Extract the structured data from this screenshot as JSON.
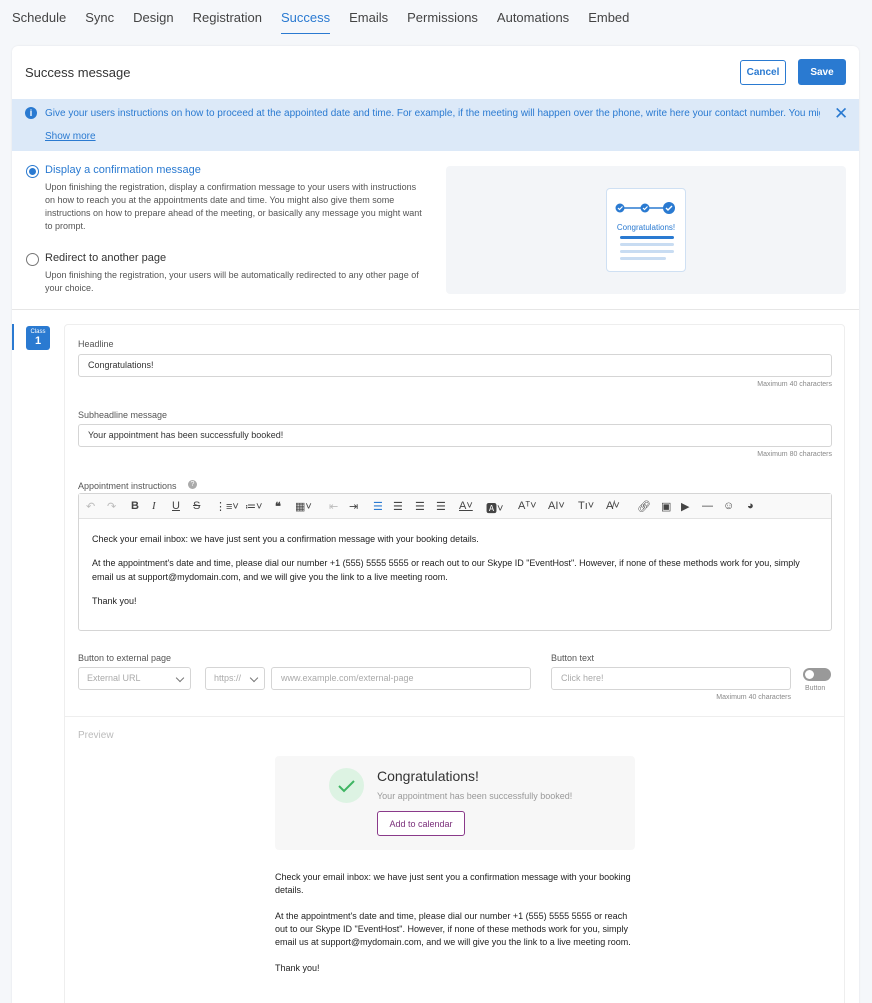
{
  "tabs": [
    "Schedule",
    "Sync",
    "Design",
    "Registration",
    "Success",
    "Emails",
    "Permissions",
    "Automations",
    "Embed"
  ],
  "active_tab": "Success",
  "card": {
    "title": "Success message",
    "cancel_label": "Cancel",
    "save_label": "Save"
  },
  "info": {
    "text": "Give your users instructions on how to proceed at the appointed date and time. For example, if the meeting will happen over the phone, write here your contact number. You might also poi...",
    "show_more": "Show more"
  },
  "options": [
    {
      "title": "Display a confirmation message",
      "selected": true,
      "desc": "Upon finishing the registration, display a confirmation message to your users with instructions on how to reach you at the appointments date and time. You might also give them some instructions on how to prepare ahead of the meeting, or basically any message you might want to prompt."
    },
    {
      "title": "Redirect to another page",
      "selected": false,
      "desc": "Upon finishing the registration, your users will be automatically redirected to any other page of your choice."
    }
  ],
  "illustration": {
    "label": "Congratulations!"
  },
  "class_badge": {
    "label": "Class",
    "number": "1"
  },
  "form": {
    "headline_label": "Headline",
    "headline_value": "Congratulations!",
    "headline_hint": "Maximum 40 characters",
    "subheadline_label": "Subheadline message",
    "subheadline_value": "Your appointment has been successfully booked!",
    "subheadline_hint": "Maximum 80 characters",
    "instructions_label": "Appointment instructions",
    "instructions_p1": "Check your email inbox: we have just sent you a confirmation message with your booking details.",
    "instructions_p2": "At the appointment's date and time, please dial our number +1 (555) 5555 5555 or reach out to our Skype ID \"EventHost\". However, if none of these methods work for you, simply email us at support@mydomain.com, and we will give you the link to a live meeting room.",
    "instructions_p3": "Thank you!",
    "external_label": "Button to external page",
    "external_select": "External URL",
    "protocol_select": "https://",
    "url_placeholder": "www.example.com/external-page",
    "button_text_label": "Button text",
    "button_text_placeholder": "Click here!",
    "button_text_hint": "Maximum 40 characters",
    "toggle_label": "Button",
    "toggle_on": false
  },
  "preview": {
    "label": "Preview",
    "headline": "Congratulations!",
    "subheadline": "Your appointment has been successfully booked!",
    "calendar_button": "Add to calendar",
    "p1": "Check your email inbox: we have just sent you a confirmation message with your booking details.",
    "p2": "At the appointment's date and time, please dial our number +1 (555) 5555 5555 or reach out to our Skype ID \"EventHost\". However, if none of these methods work for you, simply email us at support@mydomain.com, and we will give you the link to a live meeting room.",
    "p3": "Thank you!"
  },
  "colors": {
    "accent": "#2a7ad1",
    "info_bg": "#dce9f8",
    "success_green": "#3fb563",
    "calendar_purple": "#7a2f7a"
  }
}
